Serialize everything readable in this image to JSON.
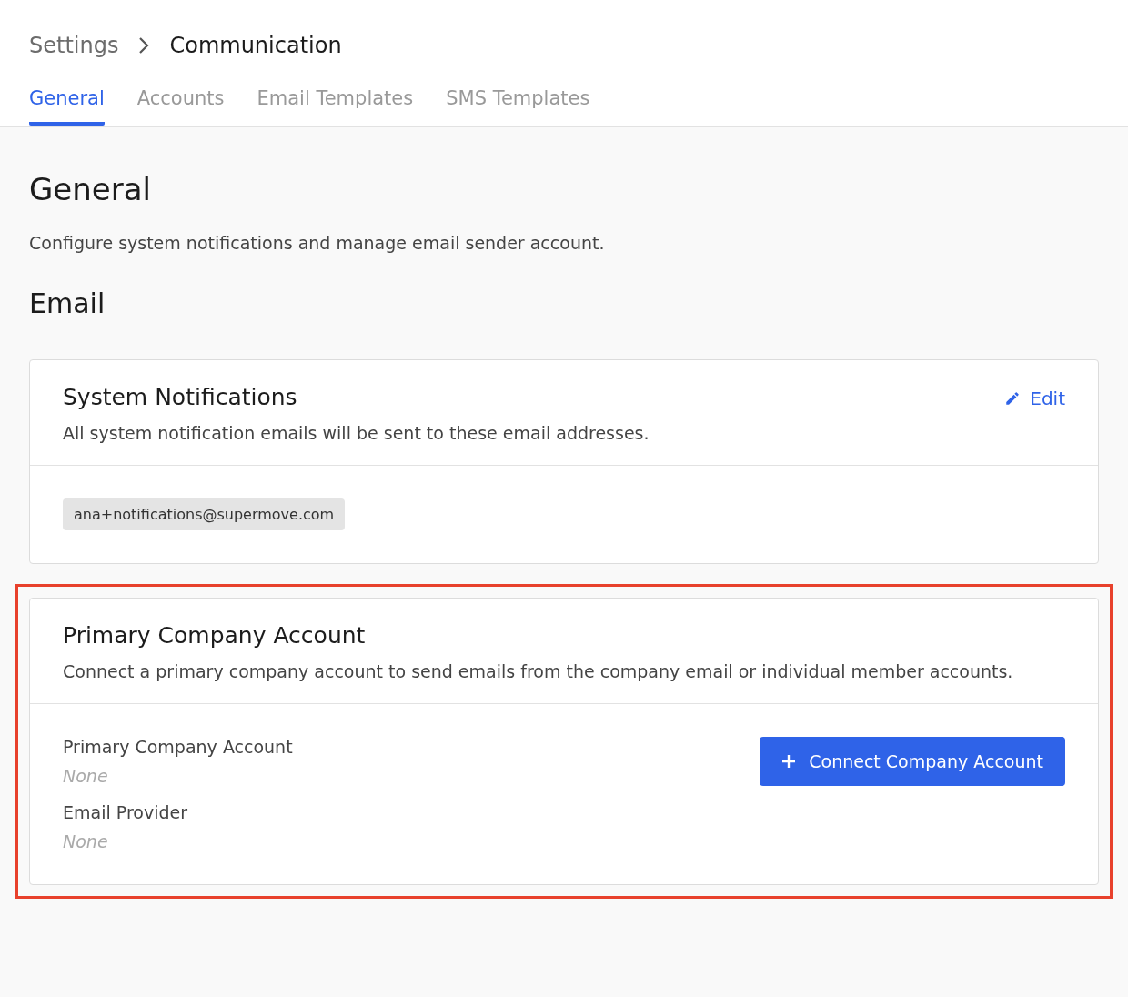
{
  "breadcrumb": [
    {
      "label": "Settings",
      "current": false
    },
    {
      "label": "Communication",
      "current": true
    }
  ],
  "tabs": [
    {
      "label": "General",
      "selected": true
    },
    {
      "label": "Accounts",
      "selected": false
    },
    {
      "label": "Email Templates",
      "selected": false
    },
    {
      "label": "SMS Templates",
      "selected": false
    }
  ],
  "page": {
    "title": "General",
    "description": "Configure system notifications and manage email sender account."
  },
  "section": {
    "title": "Email"
  },
  "cards": [
    {
      "kind": "emails",
      "title": "System Notifications",
      "subtitle": "All system notification emails will be sent to these email addresses.",
      "highlighted": false,
      "action": "Edit",
      "emails": [
        "ana+notifications@supermove.com"
      ]
    },
    {
      "kind": "account",
      "title": "Primary Company Account",
      "subtitle": "Connect a primary company account to send emails from the company email or individual member accounts.",
      "highlighted": true,
      "button": "Connect Company Account",
      "fields": [
        {
          "label": "Primary Company Account",
          "value": "None"
        },
        {
          "label": "Email Provider",
          "value": "None"
        }
      ]
    }
  ]
}
